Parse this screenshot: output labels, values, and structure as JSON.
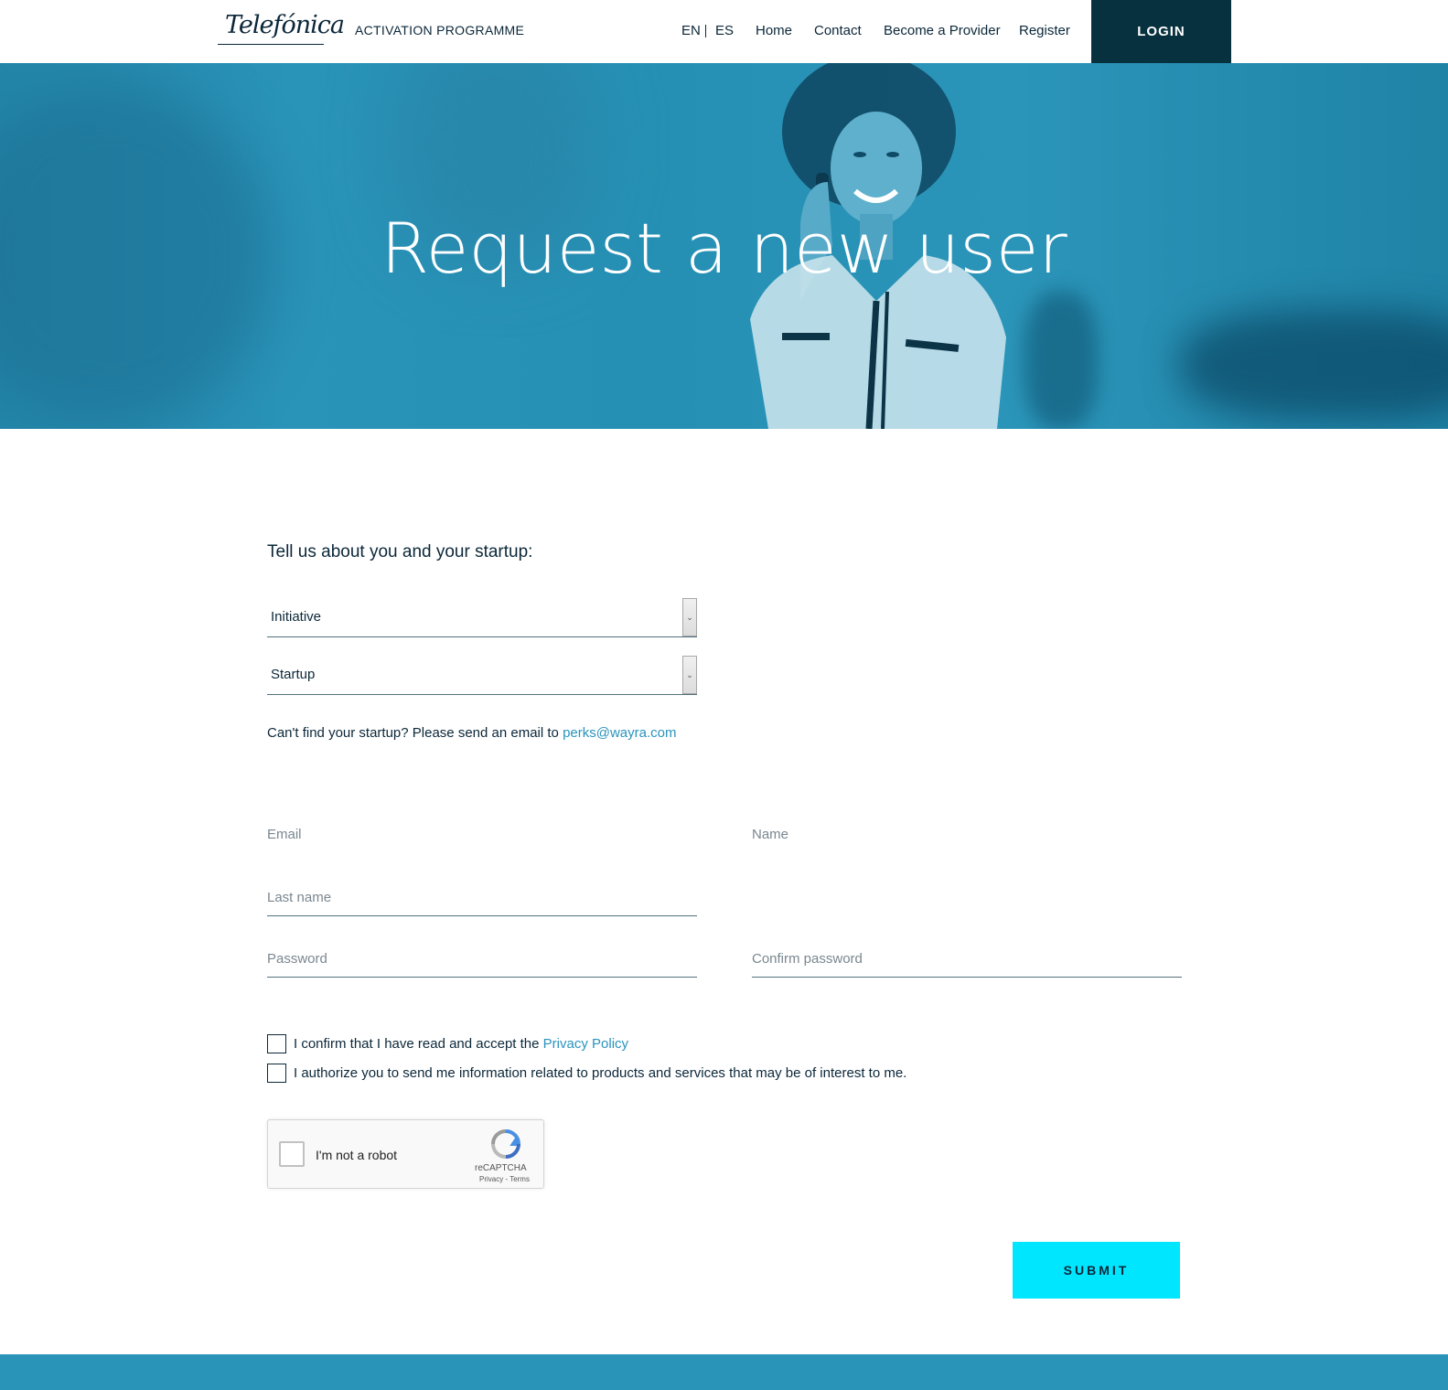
{
  "header": {
    "logo": "Telefónica",
    "programme": "ACTIVATION PROGRAMME",
    "lang_en": "EN",
    "lang_es": "ES",
    "nav": {
      "home": "Home",
      "contact": "Contact",
      "become_provider": "Become a Provider",
      "register": "Register"
    },
    "login_label": "LOGIN"
  },
  "hero": {
    "title": "Request a new user"
  },
  "form": {
    "section_title": "Tell us about you and your startup:",
    "initiative_select": "Initiative",
    "startup_select": "Startup",
    "help_text": "Can't find your startup? Please send an email to",
    "help_email": "perks@wayra.com",
    "email_placeholder": "Email",
    "name_placeholder": "Name",
    "last_name_placeholder": "Last name",
    "password_placeholder": "Password",
    "confirm_password_placeholder": "Confirm password",
    "privacy_text": "I confirm that I have read and accept the",
    "privacy_link": "Privacy Policy",
    "authorize_text": "I authorize you to send me information related to products and services that may be of interest to me.",
    "recaptcha": {
      "label": "I'm not a robot",
      "brand": "reCAPTCHA",
      "terms": "Privacy - Terms"
    },
    "submit_label": "SUBMIT"
  },
  "colors": {
    "brand_dark": "#08313f",
    "hero_blue": "#2a93b8",
    "accent_cyan": "#00e6ff",
    "link": "#2a93bd"
  }
}
